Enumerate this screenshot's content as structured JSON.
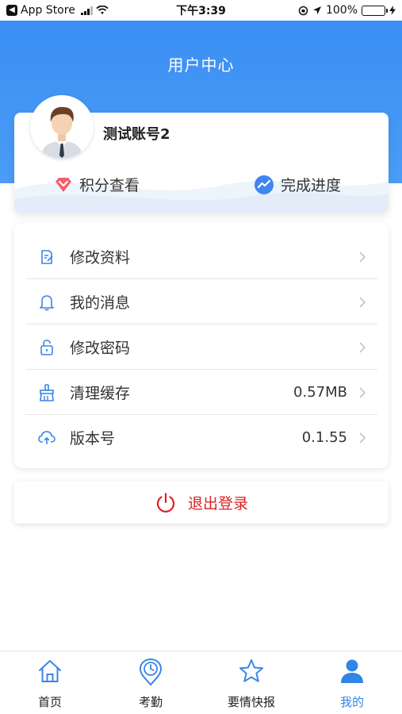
{
  "status_bar": {
    "back_app": "App Store",
    "time": "下午3:39",
    "battery": "100%"
  },
  "header": {
    "title": "用户中心"
  },
  "profile": {
    "username": "测试账号2",
    "points_label": "积分查看",
    "progress_label": "完成进度"
  },
  "menu": {
    "items": [
      {
        "label": "修改资料",
        "value": "",
        "icon": "edit-icon"
      },
      {
        "label": "我的消息",
        "value": "",
        "icon": "bell-icon"
      },
      {
        "label": "修改密码",
        "value": "",
        "icon": "lock-icon"
      },
      {
        "label": "清理缓存",
        "value": "0.57MB",
        "icon": "broom-icon"
      },
      {
        "label": "版本号",
        "value": "0.1.55",
        "icon": "cloud-upload-icon"
      }
    ]
  },
  "logout": {
    "label": "退出登录"
  },
  "tabbar": {
    "items": [
      {
        "label": "首页",
        "icon": "home-icon"
      },
      {
        "label": "考勤",
        "icon": "clock-pin-icon"
      },
      {
        "label": "要情快报",
        "icon": "star-icon"
      },
      {
        "label": "我的",
        "icon": "user-icon"
      }
    ],
    "active_index": 3
  },
  "colors": {
    "primary": "#3b8ff3",
    "logout_red": "#e02020",
    "points_red": "#f0626b",
    "active_tab": "#2f86e8"
  }
}
